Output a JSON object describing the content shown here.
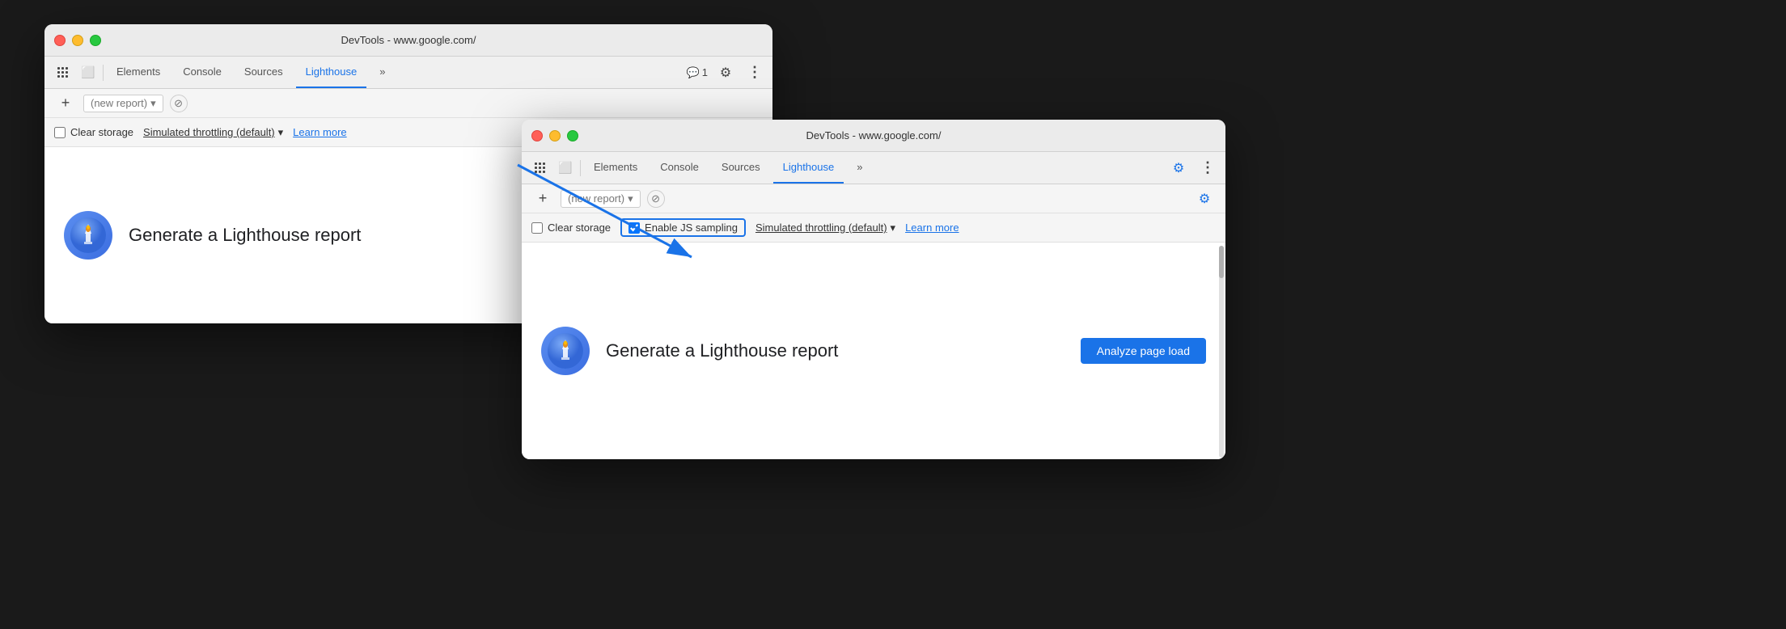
{
  "window_back": {
    "title": "DevTools - www.google.com/",
    "tabs": [
      {
        "label": "Elements",
        "active": false
      },
      {
        "label": "Console",
        "active": false
      },
      {
        "label": "Sources",
        "active": false
      },
      {
        "label": "Lighthouse",
        "active": true
      }
    ],
    "report_placeholder": "(new report)",
    "clear_storage_label": "Clear storage",
    "throttling_label": "Simulated throttling (default)",
    "learn_more_label": "Learn more",
    "generate_title": "Generate a Lighthouse report",
    "chat_badge": "1"
  },
  "window_front": {
    "title": "DevTools - www.google.com/",
    "tabs": [
      {
        "label": "Elements",
        "active": false
      },
      {
        "label": "Console",
        "active": false
      },
      {
        "label": "Sources",
        "active": false
      },
      {
        "label": "Lighthouse",
        "active": true
      }
    ],
    "report_placeholder": "(new report)",
    "clear_storage_label": "Clear storage",
    "enable_js_sampling_label": "Enable JS sampling",
    "throttling_label": "Simulated throttling (default)",
    "learn_more_label": "Learn more",
    "generate_title": "Generate a Lighthouse report",
    "analyze_btn_label": "Analyze page load"
  },
  "icons": {
    "gear": "⚙",
    "dots": "⋮",
    "plus": "+",
    "chevron": "▾",
    "circle_slash": "⊘",
    "more_tabs": "»",
    "chat": "💬",
    "search": "🔍",
    "cursor": "↖",
    "device": "⬜"
  }
}
